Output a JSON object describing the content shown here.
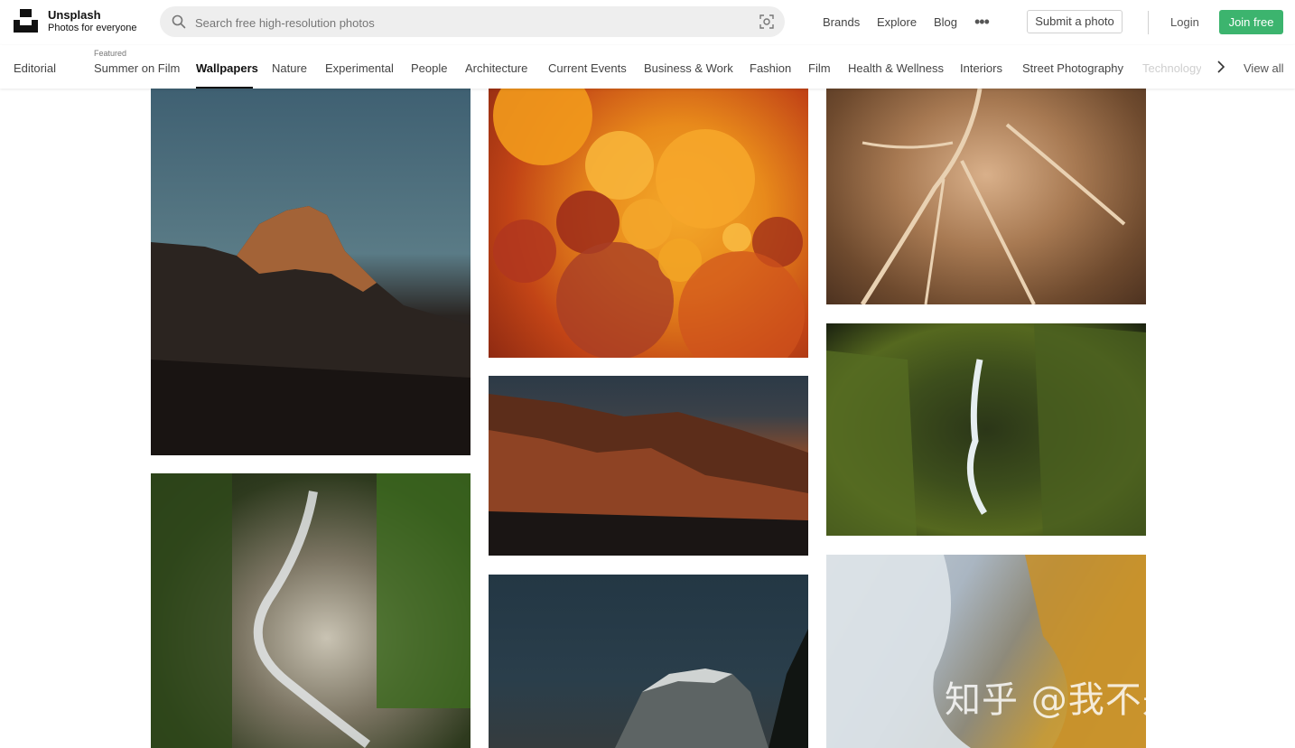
{
  "brand": {
    "name": "Unsplash",
    "tagline": "Photos for everyone"
  },
  "search": {
    "placeholder": "Search free high-resolution photos",
    "icon": "search-icon",
    "visual_search_icon": "visual-search-icon"
  },
  "nav": {
    "links": [
      "Brands",
      "Explore",
      "Blog"
    ],
    "more": "•••",
    "submit": "Submit a photo",
    "login": "Login",
    "join": "Join free"
  },
  "colors": {
    "join_button": "#3cb46e",
    "search_bg": "#eeeeee"
  },
  "topics": {
    "editorial": "Editorial",
    "featured_caption": "Featured",
    "items": [
      "Summer on Film",
      "Wallpapers",
      "Nature",
      "Experimental",
      "People",
      "Architecture",
      "Current Events",
      "Business & Work",
      "Fashion",
      "Film",
      "Health & Wellness",
      "Interiors",
      "Street Photography",
      "Technology"
    ],
    "active": "Wallpapers",
    "view_all": "View all"
  },
  "photos": [
    "mountain-peak-at-dusk",
    "forest-waterfall-cascade",
    "orange-oil-bubbles",
    "red-eroded-hills",
    "granite-dome",
    "aerial-brown-river-delta",
    "mossy-canyon-waterfall",
    "aerial-ice-and-sand"
  ],
  "watermark": "知乎 @我不是大师"
}
